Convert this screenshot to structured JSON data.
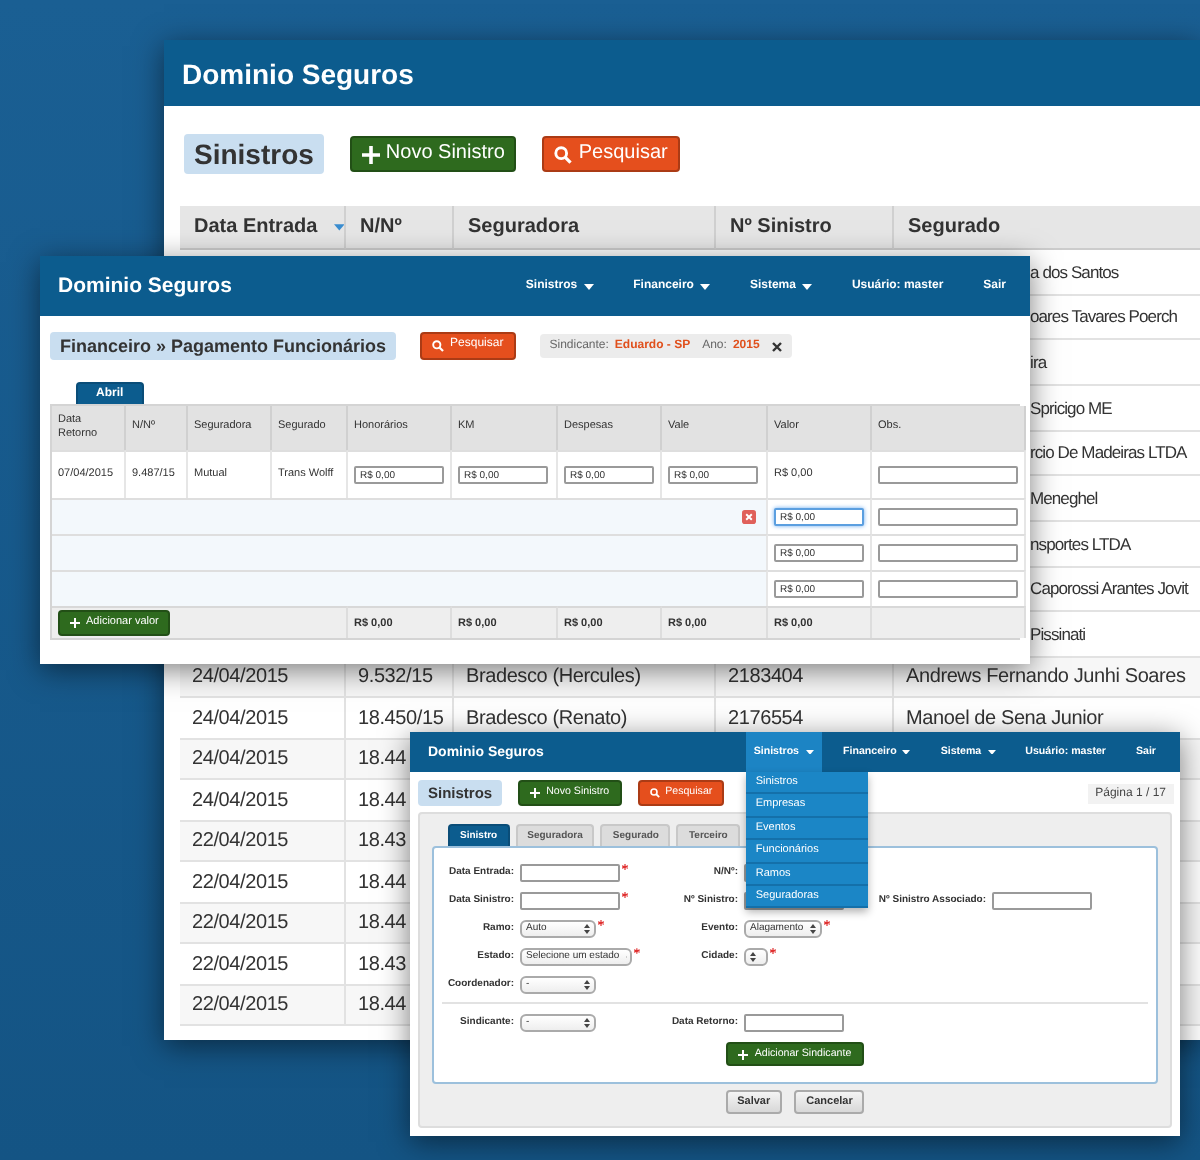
{
  "sinistros_list_window": {
    "title": "Dominio Seguros",
    "heading": "Sinistros",
    "buttons": [
      {
        "kind": "new",
        "label": "Novo Sinistro"
      },
      {
        "kind": "search",
        "label": "Pesquisar"
      }
    ],
    "table": {
      "columns": [
        "Data Entrada",
        "N/Nº",
        "Seguradora",
        "Nº Sinistro",
        "Segurado"
      ],
      "rows": [
        {
          "kind": "covered",
          "segurado": "a dos Santos"
        },
        {
          "kind": "covered",
          "segurado": "oares Tavares Poerch"
        },
        {
          "kind": "covered",
          "segurado": "ira"
        },
        {
          "kind": "covered",
          "segurado": "Spricigo ME"
        },
        {
          "kind": "covered",
          "segurado": "rcio De Madeiras LTDA"
        },
        {
          "kind": "covered",
          "segurado": "Meneghel"
        },
        {
          "kind": "covered",
          "segurado": "nsportes LTDA"
        },
        {
          "kind": "covered",
          "segurado": "Caporossi Arantes Jovit"
        },
        {
          "kind": "covered",
          "segurado": "Pissinati"
        },
        {
          "kind": "full",
          "data_entrada": "24/04/2015",
          "nn": "9.532/15",
          "seguradora": "Bradesco (Hercules)",
          "n_sinistro": "2183404",
          "segurado": "Andrews Fernando Junhi Soares"
        },
        {
          "kind": "full",
          "data_entrada": "24/04/2015",
          "nn": "18.450/15",
          "seguradora": "Bradesco (Renato)",
          "n_sinistro": "2176554",
          "segurado": "Manoel de Sena Junior"
        },
        {
          "kind": "partial",
          "data_entrada": "24/04/2015",
          "nn": "18.44"
        },
        {
          "kind": "partial",
          "data_entrada": "24/04/2015",
          "nn": "18.44"
        },
        {
          "kind": "partial",
          "data_entrada": "22/04/2015",
          "nn": "18.43"
        },
        {
          "kind": "partial",
          "data_entrada": "22/04/2015",
          "nn": "18.44"
        },
        {
          "kind": "partial",
          "data_entrada": "22/04/2015",
          "nn": "18.44"
        },
        {
          "kind": "partial",
          "data_entrada": "22/04/2015",
          "nn": "18.43"
        },
        {
          "kind": "partial",
          "data_entrada": "22/04/2015",
          "nn": "18.44"
        }
      ]
    }
  },
  "payment_window": {
    "title": "Dominio Seguros",
    "nav": [
      {
        "label": "Sinistros",
        "dropdown": true,
        "open": false
      },
      {
        "label": "Financeiro",
        "dropdown": true,
        "open": false
      },
      {
        "label": "Sistema",
        "dropdown": true,
        "open": false
      },
      {
        "label": "Usuário: master",
        "dropdown": false,
        "open": false
      },
      {
        "label": "Sair",
        "dropdown": false,
        "open": false
      }
    ],
    "heading": "Financeiro » Pagamento Funcionários",
    "search_button": "Pesquisar",
    "filter": [
      {
        "label": "Sindicante:",
        "value": "Eduardo - SP"
      },
      {
        "label": "Ano:",
        "value": "2015"
      }
    ],
    "tabs": [
      {
        "label": "Abril",
        "selected": true
      }
    ],
    "table": {
      "columns": [
        "Data Retorno",
        "N/Nº",
        "Seguradora",
        "Segurado",
        "Honorários",
        "KM",
        "Despesas",
        "Vale",
        "Valor",
        "Obs."
      ],
      "rows": [
        {
          "kind": "record",
          "cells": [
            "07/04/2015",
            "9.487/15",
            "Mutual",
            "Trans Wolff"
          ],
          "inputs": [
            "R$ 0,00",
            "R$ 0,00",
            "R$ 0,00",
            "R$ 0,00"
          ],
          "valor": "R$ 0,00"
        },
        {
          "kind": "extra",
          "deletable": true,
          "focused": true,
          "valor": "R$ 0,00"
        },
        {
          "kind": "extra",
          "deletable": false,
          "focused": false,
          "valor": "R$ 0,00"
        },
        {
          "kind": "extra",
          "deletable": false,
          "focused": false,
          "valor": "R$ 0,00"
        }
      ],
      "footer": {
        "button": "Adicionar valor",
        "totals": [
          "R$ 0,00",
          "R$ 0,00",
          "R$ 0,00",
          "R$ 0,00",
          "R$ 0,00"
        ]
      }
    }
  },
  "sinistro_form_window": {
    "title": "Dominio Seguros",
    "nav": [
      {
        "label": "Sinistros",
        "dropdown": true,
        "open": true
      },
      {
        "label": "Financeiro",
        "dropdown": true,
        "open": false
      },
      {
        "label": "Sistema",
        "dropdown": true,
        "open": false
      },
      {
        "label": "Usuário: master",
        "dropdown": false,
        "open": false
      },
      {
        "label": "Sair",
        "dropdown": false,
        "open": false
      }
    ],
    "menu": [
      "Sinistros",
      "Empresas",
      "Eventos",
      "Funcionários",
      "Ramos",
      "Seguradoras"
    ],
    "heading": "Sinistros",
    "buttons": [
      {
        "kind": "new",
        "label": "Novo Sinistro"
      },
      {
        "kind": "search",
        "label": "Pesquisar"
      }
    ],
    "page_label": "Página 1 / 17",
    "tabs": [
      {
        "label": "Sinistro",
        "selected": true
      },
      {
        "label": "Seguradora",
        "selected": false
      },
      {
        "label": "Segurado",
        "selected": false
      },
      {
        "label": "Terceiro",
        "selected": false
      }
    ],
    "sections": [
      {
        "rows": [
          [
            {
              "kind": "text",
              "label": "Data Entrada:",
              "required": true
            },
            {
              "kind": "text",
              "label": "N/Nº:",
              "required": false
            }
          ],
          [
            {
              "kind": "text",
              "label": "Data Sinistro:",
              "required": true
            },
            {
              "kind": "text",
              "label": "Nº Sinistro:",
              "required": false
            },
            {
              "kind": "text",
              "label": "Nº Sinistro Associado:",
              "required": false
            }
          ],
          [
            {
              "kind": "select",
              "label": "Ramo:",
              "value": "Auto",
              "required": true
            },
            {
              "kind": "select",
              "label": "Evento:",
              "value": "Alagamento",
              "required": true
            }
          ],
          [
            {
              "kind": "select",
              "label": "Estado:",
              "value": "Selecione um estado",
              "required": true
            },
            {
              "kind": "select",
              "label": "Cidade:",
              "required": true
            }
          ],
          [
            {
              "kind": "select",
              "label": "Coordenador:",
              "value": "-",
              "required": false
            }
          ]
        ]
      },
      {
        "rows": [
          [
            {
              "kind": "select",
              "label": "Sindicante:",
              "value": "-",
              "required": false
            },
            {
              "kind": "text",
              "label": "Data Retorno:",
              "required": false
            }
          ]
        ],
        "button": "Adicionar Sindicante"
      }
    ],
    "actions": [
      "Salvar",
      "Cancelar"
    ]
  }
}
